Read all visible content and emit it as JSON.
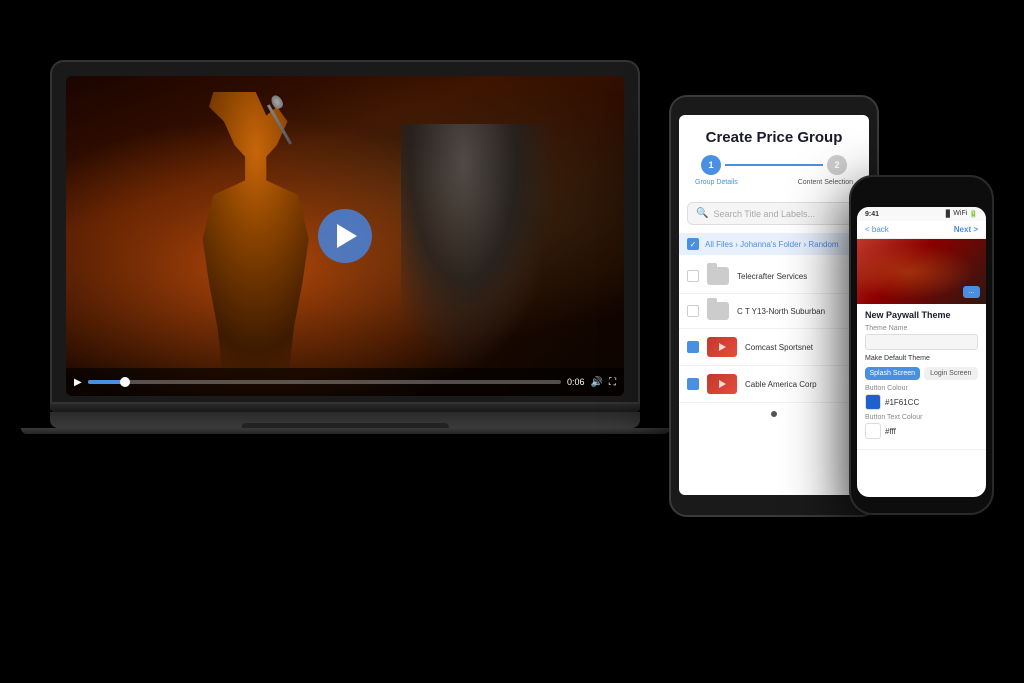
{
  "scene": {
    "bg": "#000000"
  },
  "laptop": {
    "screen": {
      "video_label": "Concert performance video"
    },
    "controls": {
      "time": "0:06",
      "play_label": "▶"
    }
  },
  "tablet": {
    "title": "Create Price Group",
    "steps": {
      "step1_label": "Group Details",
      "step2_label": "Content Selection",
      "step1_number": "1",
      "step2_number": "2"
    },
    "search_placeholder": "Search Title and Labels...",
    "breadcrumb": "All Files › Johanna's Folder › Random",
    "files": [
      {
        "name": "Telecrafter Services",
        "type": "folder",
        "checked": false
      },
      {
        "name": "C T Y13-North Suburban",
        "type": "folder",
        "checked": false
      },
      {
        "name": "Comcast Sportsnet",
        "type": "video",
        "checked": true
      },
      {
        "name": "Cable America Corp",
        "type": "video",
        "checked": true
      }
    ]
  },
  "phone": {
    "time": "9:41",
    "nav_back": "< back",
    "nav_next": "Next >",
    "section_title": "New Paywall Theme",
    "theme_name_label": "Theme Name",
    "theme_name_value": "",
    "default_label": "Make Default Theme",
    "button_color_label": "Button Colour",
    "button_color_value": "#1F61CC",
    "button_color_swatch": "#1f61cc",
    "button_text_label": "Button Text Colour",
    "button_text_value": "#fff",
    "button_text_swatch": "#ffffff",
    "tab_splash": "Splash Screen",
    "tab_login": "Login Screen",
    "splash_tab_active": true
  }
}
